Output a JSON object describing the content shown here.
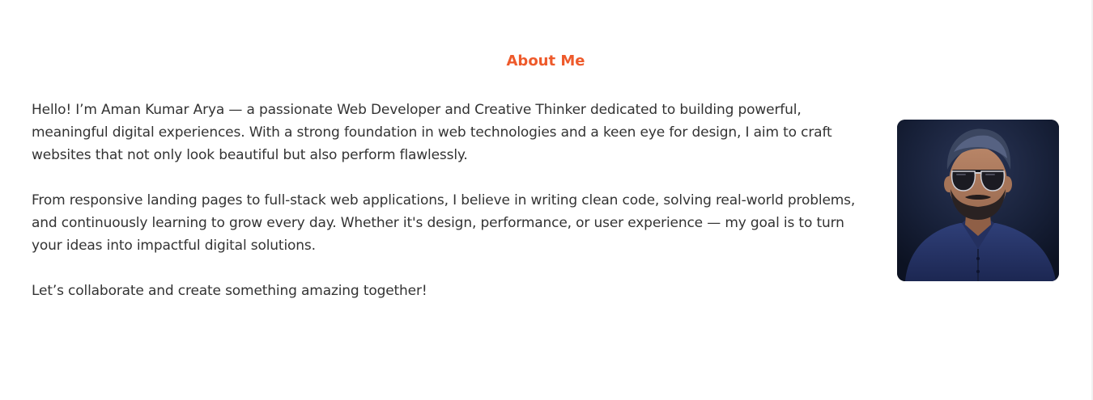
{
  "about": {
    "title": "About Me",
    "paragraphs": [
      "Hello! I’m Aman Kumar Arya — a passionate Web Developer and Creative Thinker dedicated to building powerful, meaningful digital experiences. With a strong foundation in web technologies and a keen eye for design, I aim to craft websites that not only look beautiful but also perform flawlessly.",
      "From responsive landing pages to full-stack web applications, I believe in writing clean code, solving real-world problems, and continuously learning to grow every day. Whether it's design, performance, or user experience — my goal is to turn your ideas into impactful digital solutions.",
      "Let’s collaborate and create something amazing together!"
    ],
    "colors": {
      "accent": "#ee5a2b",
      "text": "#333333",
      "background": "#ffffff"
    }
  }
}
